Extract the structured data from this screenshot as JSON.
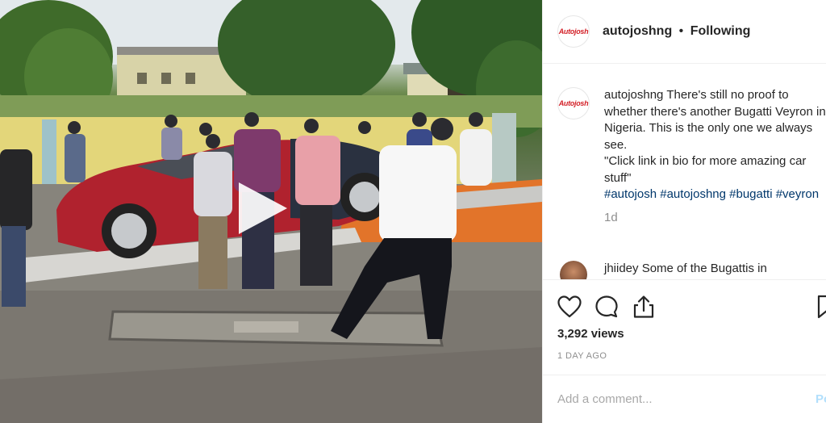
{
  "media": {
    "type": "video",
    "play_icon": "play-icon"
  },
  "post": {
    "header": {
      "username": "autojoshng",
      "separator": "•",
      "follow_status": "Following",
      "avatar_logo": "Autojosh"
    },
    "caption": {
      "username": "autojoshng",
      "text": "There's still no proof to whether there's another Bugatti Veyron in Nigeria. This is the only one we always see.",
      "quote": "\"Click link in bio for more amazing car stuff\"",
      "hashtags": [
        "#autojosh",
        "#autojoshng",
        "#bugatti",
        "#veyron"
      ],
      "time_ago": "1d"
    },
    "comments": [
      {
        "username": "jhiidey",
        "text": "Some of the Bugattis in"
      }
    ],
    "actions": {
      "like_icon": "heart-icon",
      "comment_icon": "comment-icon",
      "share_icon": "share-icon",
      "save_icon": "bookmark-icon"
    },
    "views": "3,292 views",
    "date": "1 DAY AGO",
    "add_comment": {
      "placeholder": "Add a comment...",
      "post_label": "Post"
    }
  },
  "colors": {
    "hashtag": "#00376b",
    "muted": "#8e8e8e",
    "post_button_disabled": "#b2dffc",
    "logo_red": "#d32128"
  }
}
